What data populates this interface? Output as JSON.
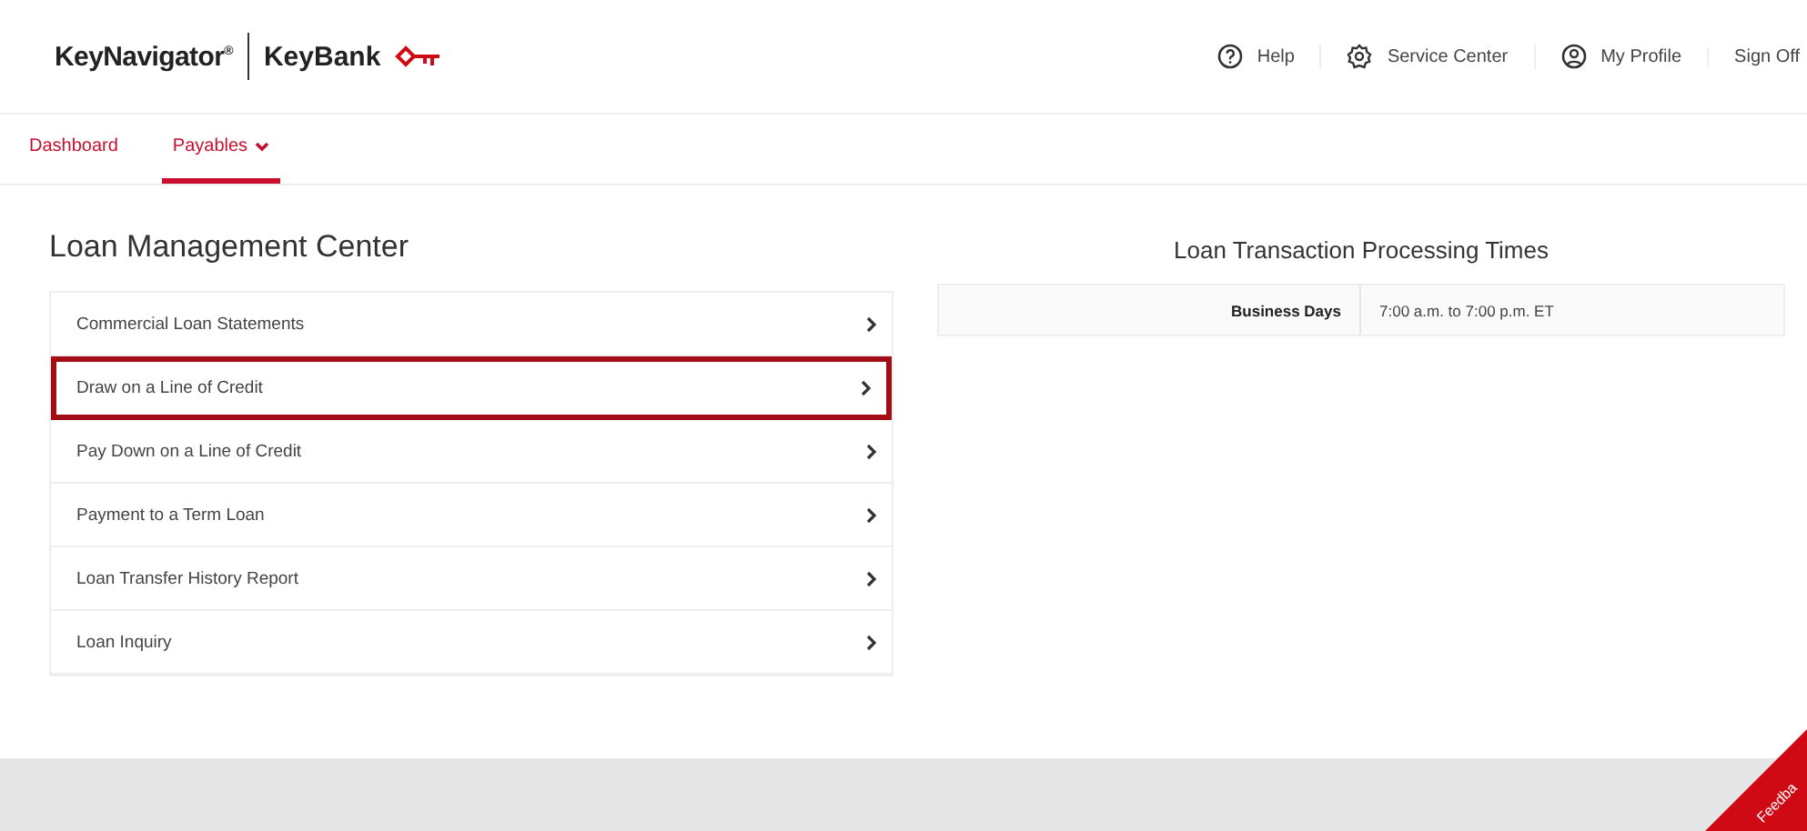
{
  "header": {
    "product": "KeyNavigator",
    "product_mark": "®",
    "brand": "KeyBank",
    "links": [
      {
        "kind": "help",
        "label": "Help"
      },
      {
        "kind": "settings",
        "label": "Service Center"
      },
      {
        "kind": "profile",
        "label": "My Profile"
      },
      {
        "kind": "none",
        "label": "Sign Off"
      }
    ]
  },
  "nav": [
    {
      "label": "Dashboard",
      "selected": false,
      "dropdown": false
    },
    {
      "label": "Payables",
      "selected": true,
      "dropdown": true
    }
  ],
  "loan_center": {
    "title": "Loan Management Center",
    "items": [
      {
        "label": "Commercial Loan Statements",
        "highlighted": false
      },
      {
        "label": "Draw on a Line of Credit",
        "highlighted": true
      },
      {
        "label": "Pay Down on a Line of Credit",
        "highlighted": false
      },
      {
        "label": "Payment to a Term Loan",
        "highlighted": false
      },
      {
        "label": "Loan Transfer History Report",
        "highlighted": false
      },
      {
        "label": "Loan Inquiry",
        "highlighted": false
      }
    ]
  },
  "processing_times": {
    "title": "Loan Transaction Processing Times",
    "rows": [
      {
        "label": "Business Days",
        "value": "7:00 a.m. to 7:00 p.m. ET"
      }
    ]
  },
  "feedback_tab": "Feedba"
}
